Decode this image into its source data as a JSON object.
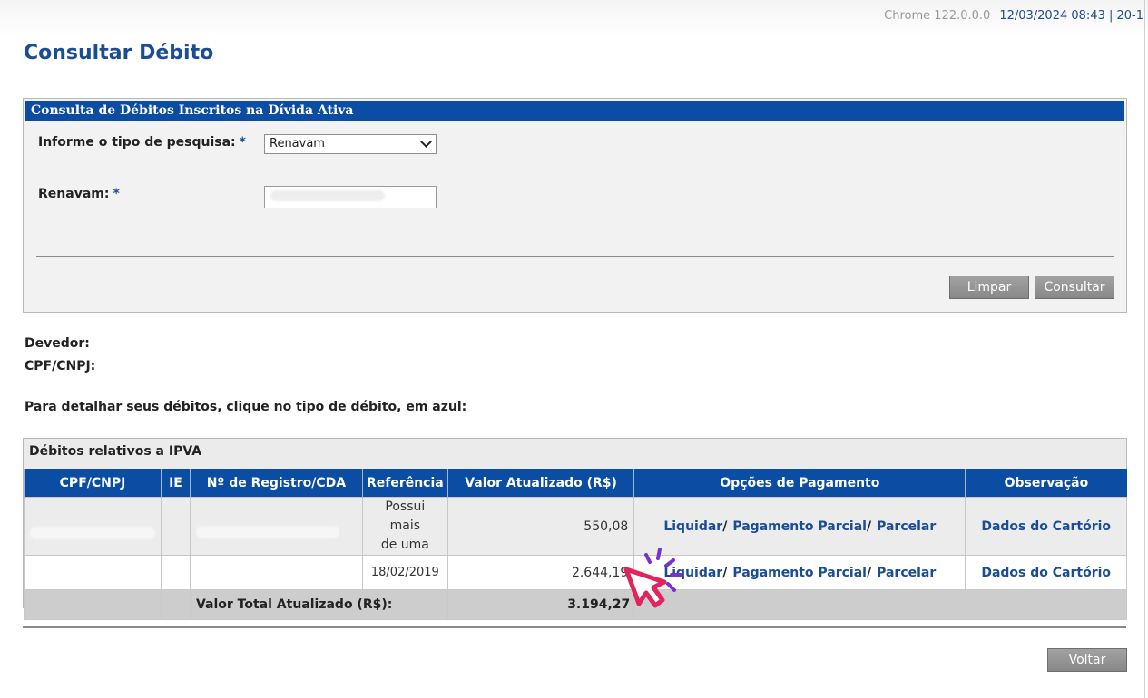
{
  "topbar": {
    "browser": "Chrome 122.0.0.0",
    "stamp": "12/03/2024 08:43 | 20-1"
  },
  "page": {
    "title": "Consultar Débito"
  },
  "search_panel": {
    "header": "Consulta de Débitos Inscritos na Dívida Ativa",
    "search_type_label": "Informe o tipo de pesquisa:",
    "required_mark": "*",
    "search_type_value": "Renavam",
    "renavam_label": "Renavam:",
    "clear_button": "Limpar",
    "submit_button": "Consultar"
  },
  "debtor": {
    "devedor_label": "Devedor:",
    "cpf_label": "CPF/CNPJ:"
  },
  "instruction": "Para detalhar seus débitos, clique no tipo de débito, em azul:",
  "ipva": {
    "header": "Débitos relativos a IPVA",
    "columns": [
      "CPF/CNPJ",
      "IE",
      "Nº de Registro/CDA",
      "Referência",
      "Valor Atualizado (R$)",
      "Opções de Pagamento",
      "Observação"
    ],
    "rows": [
      {
        "referencia_line1": "Possui mais",
        "referencia_line2": "de uma",
        "valor": "550,08",
        "observacao": "Dados do Cartório"
      },
      {
        "referencia": "18/02/2019",
        "valor": "2.644,19",
        "observacao": "Dados do Cartório"
      }
    ],
    "payment_options": {
      "liquidar": "Liquidar",
      "pagamento_parcial": "Pagamento Parcial",
      "parcelar": "Parcelar",
      "separator": "/"
    },
    "total_label": "Valor Total Atualizado (R$):",
    "total_value": "3.194,27"
  },
  "footer": {
    "back_button": "Voltar"
  },
  "colors": {
    "primary": "#0b4da2",
    "link": "#1a4d96",
    "cursor": "#e0245e",
    "cursor_rays": "#7a2fd0"
  }
}
